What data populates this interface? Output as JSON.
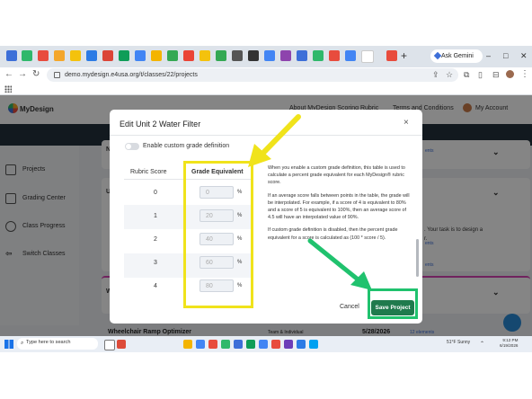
{
  "browser": {
    "new_tab_symbol": "+",
    "gemini_label": "Ask Gemini",
    "url": "demo.mydesign.e4usa.org/t/classes/22/projects",
    "window_controls": [
      "–",
      "□",
      "✕"
    ]
  },
  "app": {
    "logo_text": "MyDesign",
    "nav_about": "About MyDesign Scoring Rubric",
    "nav_terms": "Terms and Conditions",
    "account_label": "My Account",
    "sidebar": [
      {
        "label": "Projects"
      },
      {
        "label": "Grading Center"
      },
      {
        "label": "Class Progress"
      },
      {
        "label": "Switch Classes"
      }
    ],
    "bg_fragments": {
      "left_n": "N",
      "left_u": "U",
      "left_w": "W",
      "elements_a": "ents",
      "elements_b": "ents",
      "elements_c": "ents",
      "task_text": ". Your task is to design a",
      "task_text2": "r."
    },
    "bottom_row": {
      "title": "Wheelchair Ramp Optimizer",
      "team": "Team & Individual",
      "date": "5/28/2026",
      "elements": "12 elements"
    }
  },
  "modal": {
    "title": "Edit Unit 2 Water Filter",
    "close_symbol": "×",
    "toggle_label": "Enable custom grade definition",
    "col_score": "Rubric Score",
    "col_grade": "Grade Equivalent",
    "rows": [
      {
        "score": "0",
        "grade": "0",
        "unit": "%"
      },
      {
        "score": "1",
        "grade": "20",
        "unit": "%"
      },
      {
        "score": "2",
        "grade": "40",
        "unit": "%"
      },
      {
        "score": "3",
        "grade": "60",
        "unit": "%"
      },
      {
        "score": "4",
        "grade": "80",
        "unit": "%"
      }
    ],
    "help": [
      "When you enable a custom grade definition, this table is used to calculate a percent grade equivalent for each MyDesign® rubric score.",
      "If an average score falls between points in the table, the grade will be interpolated. For example, if a score of 4 is equivalent to 80% and a score of 5 is equivalent to 100%, then an average score of 4.5 will have an interpolated value of 90%.",
      "If custom grade definition is disabled, then the percent grade equivalent for a score is calculated as (100 * score / 5)."
    ],
    "cancel_label": "Cancel",
    "save_label": "Save Project"
  },
  "taskbar": {
    "search_placeholder": "Type here to search",
    "weather": "51°F  Sunny",
    "time": "9:12 PM",
    "date": "6/19/2026"
  },
  "colors": {
    "annotation_yellow": "#f0e31b",
    "annotation_green": "#20c26e",
    "save_button": "#1f7a4d"
  }
}
